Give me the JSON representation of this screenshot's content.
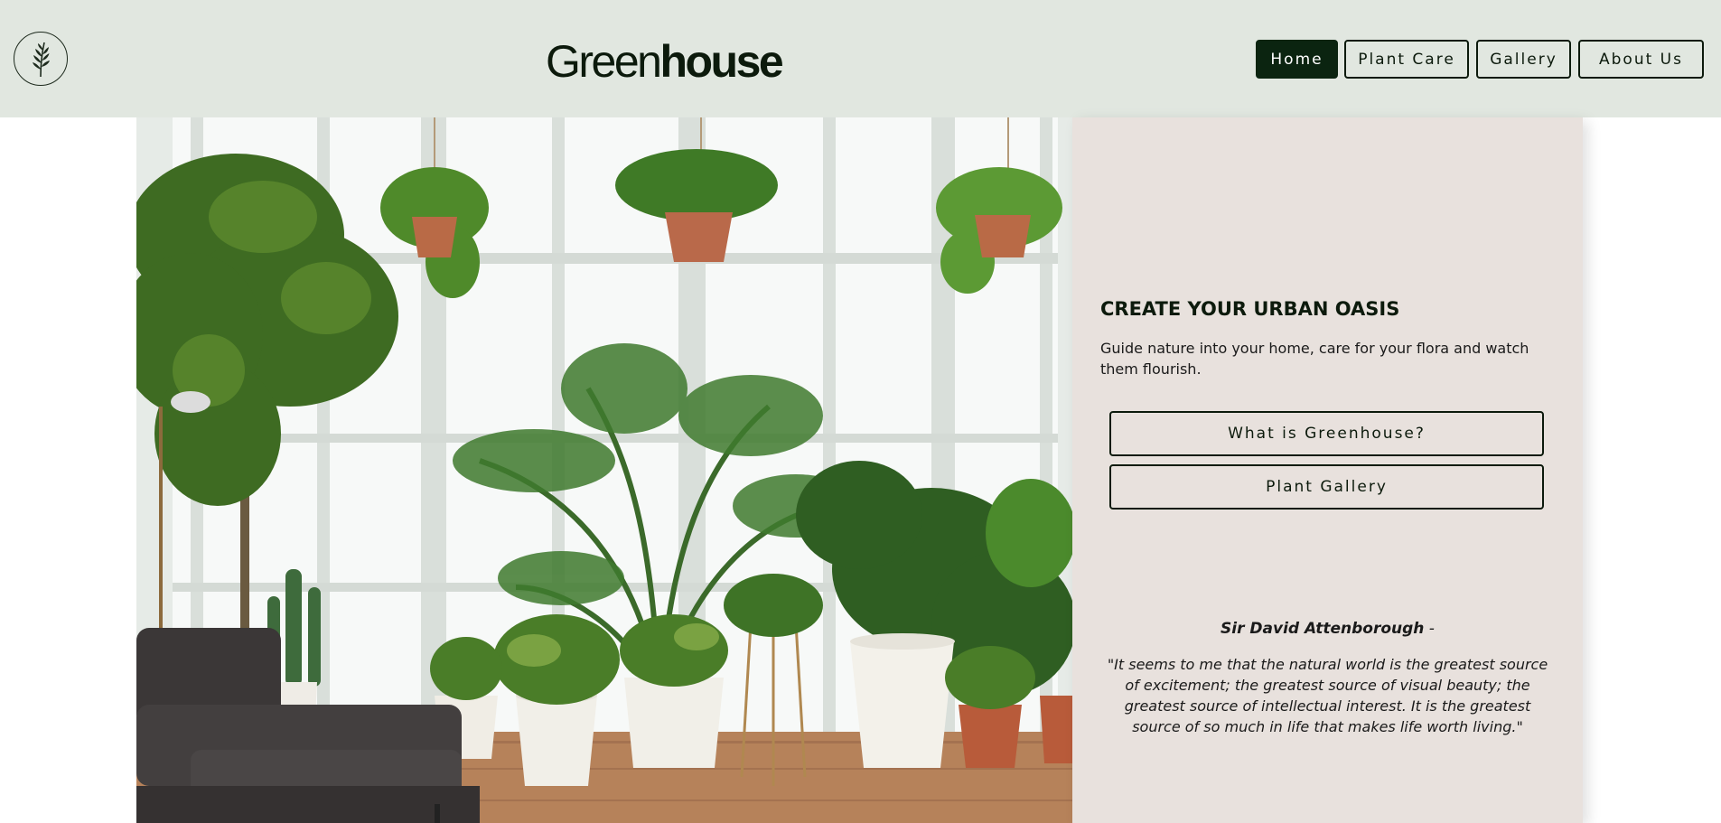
{
  "header": {
    "logo_icon": "fern-leaf-icon",
    "brand_light": "Green",
    "brand_bold": "house"
  },
  "nav": {
    "items": [
      {
        "label": "Home",
        "active": true
      },
      {
        "label": "Plant Care",
        "active": false
      },
      {
        "label": "Gallery",
        "active": false
      },
      {
        "label": "About Us",
        "active": false
      }
    ]
  },
  "hero": {
    "image_icon": "indoor-plants-photo",
    "title": "CREATE YOUR URBAN OASIS",
    "description": "Guide nature into your home, care for your flora and watch them flourish.",
    "buttons": [
      "What is Greenhouse?",
      "Plant Gallery"
    ],
    "quote_author": "Sir David Attenborough",
    "quote_dash": " -",
    "quote": "\"It seems to me that the natural world is the greatest source of excitement; the greatest source of visual beauty; the greatest source of intellectual interest. It is the greatest source of so much in life that makes life worth living.\""
  },
  "colors": {
    "header_bg": "#e1e7e0",
    "panel_bg": "#e8e1dd",
    "accent_dark": "#0b2410"
  }
}
